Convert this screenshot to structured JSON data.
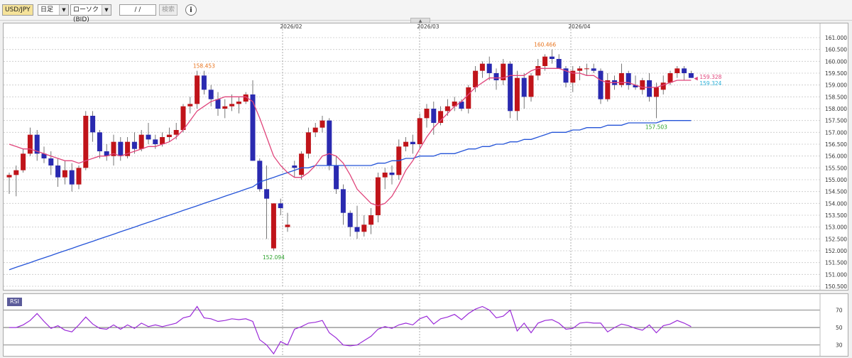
{
  "toolbar": {
    "symbol": "USD/JPY",
    "timeframe": "日足",
    "chart_type": "ローソク(BID)",
    "date_input": "/ /",
    "search_label": "検索",
    "info_icon": "info-icon"
  },
  "chart_data": [
    {
      "type": "candlestick",
      "title": "",
      "x_tick_labels": [
        "2026/02",
        "2026/03",
        "2026/04"
      ],
      "ylim": [
        150.5,
        161.0
      ],
      "y_ticks": [
        "161.000",
        "160.500",
        "160.000",
        "159.500",
        "159.000",
        "158.500",
        "158.000",
        "157.500",
        "157.000",
        "156.500",
        "156.000",
        "155.500",
        "155.000",
        "154.500",
        "154.000",
        "153.500",
        "153.000",
        "152.500",
        "152.000",
        "151.500",
        "151.000",
        "150.500"
      ],
      "grid": true,
      "candles": [
        [
          155.1,
          155.3,
          154.4,
          155.2
        ],
        [
          155.2,
          155.6,
          154.3,
          155.4
        ],
        [
          155.4,
          156.3,
          155.3,
          156.1
        ],
        [
          156.1,
          157.2,
          156.0,
          156.9
        ],
        [
          156.9,
          157.1,
          155.8,
          156.1
        ],
        [
          156.1,
          156.4,
          155.7,
          155.9
        ],
        [
          155.9,
          156.2,
          155.2,
          155.6
        ],
        [
          155.6,
          155.9,
          154.7,
          155.1
        ],
        [
          155.1,
          155.8,
          154.8,
          155.4
        ],
        [
          155.4,
          155.7,
          154.5,
          154.8
        ],
        [
          154.8,
          155.6,
          154.6,
          155.5
        ],
        [
          155.5,
          157.9,
          155.4,
          157.7
        ],
        [
          157.7,
          157.9,
          156.6,
          157.0
        ],
        [
          157.0,
          157.1,
          155.9,
          156.2
        ],
        [
          156.2,
          156.5,
          155.8,
          156.0
        ],
        [
          156.0,
          156.9,
          155.6,
          156.6
        ],
        [
          156.6,
          156.8,
          155.8,
          156.0
        ],
        [
          156.0,
          156.8,
          155.9,
          156.6
        ],
        [
          156.6,
          157.0,
          156.1,
          156.3
        ],
        [
          156.3,
          157.1,
          156.2,
          156.9
        ],
        [
          156.9,
          157.4,
          156.5,
          156.7
        ],
        [
          156.7,
          156.9,
          156.3,
          156.5
        ],
        [
          156.5,
          157.0,
          156.4,
          156.8
        ],
        [
          156.8,
          157.2,
          156.6,
          156.9
        ],
        [
          156.9,
          157.4,
          156.7,
          157.1
        ],
        [
          157.1,
          158.2,
          157.0,
          158.1
        ],
        [
          158.1,
          158.5,
          157.8,
          158.2
        ],
        [
          158.2,
          159.6,
          158.0,
          159.4
        ],
        [
          159.4,
          159.6,
          158.6,
          158.8
        ],
        [
          158.8,
          159.0,
          158.1,
          158.4
        ],
        [
          158.4,
          158.7,
          157.7,
          158.0
        ],
        [
          158.0,
          158.4,
          157.6,
          158.1
        ],
        [
          158.1,
          158.6,
          157.9,
          158.2
        ],
        [
          158.2,
          158.5,
          157.8,
          158.3
        ],
        [
          158.3,
          158.7,
          158.2,
          158.6
        ],
        [
          158.6,
          159.2,
          155.8,
          155.8
        ],
        [
          155.8,
          155.9,
          154.5,
          154.6
        ],
        [
          154.6,
          155.6,
          152.5,
          154.2
        ],
        [
          152.1,
          154.0,
          152.0,
          154.0
        ],
        [
          154.0,
          154.2,
          153.5,
          153.8
        ],
        [
          153.0,
          153.6,
          152.8,
          153.1
        ],
        [
          155.6,
          155.8,
          155.1,
          155.5
        ],
        [
          155.2,
          156.2,
          155.0,
          156.1
        ],
        [
          156.1,
          157.2,
          155.9,
          157.0
        ],
        [
          157.0,
          157.4,
          156.8,
          157.2
        ],
        [
          157.2,
          157.7,
          157.0,
          157.5
        ],
        [
          157.5,
          157.6,
          155.4,
          155.6
        ],
        [
          155.6,
          156.0,
          154.4,
          154.6
        ],
        [
          154.6,
          154.8,
          153.1,
          153.6
        ],
        [
          153.6,
          153.7,
          152.6,
          153.0
        ],
        [
          153.0,
          153.9,
          152.5,
          152.8
        ],
        [
          152.8,
          153.5,
          152.6,
          153.1
        ],
        [
          153.1,
          153.8,
          152.7,
          153.5
        ],
        [
          153.5,
          155.3,
          153.2,
          155.1
        ],
        [
          155.1,
          155.5,
          154.6,
          155.3
        ],
        [
          155.3,
          155.6,
          154.8,
          155.2
        ],
        [
          155.2,
          156.7,
          155.0,
          156.4
        ],
        [
          156.4,
          156.8,
          156.2,
          156.6
        ],
        [
          156.6,
          156.9,
          156.1,
          156.5
        ],
        [
          156.5,
          157.8,
          156.3,
          157.6
        ],
        [
          157.6,
          158.2,
          157.2,
          158.0
        ],
        [
          158.0,
          158.3,
          156.9,
          157.4
        ],
        [
          157.4,
          158.1,
          157.3,
          157.9
        ],
        [
          157.9,
          158.4,
          157.7,
          158.1
        ],
        [
          158.1,
          158.5,
          157.9,
          158.3
        ],
        [
          158.3,
          158.4,
          157.9,
          158.0
        ],
        [
          158.0,
          159.0,
          157.8,
          158.9
        ],
        [
          158.9,
          159.8,
          158.7,
          159.6
        ],
        [
          159.6,
          160.0,
          159.3,
          159.9
        ],
        [
          159.9,
          160.2,
          159.2,
          159.5
        ],
        [
          159.5,
          159.7,
          158.8,
          159.2
        ],
        [
          159.2,
          160.1,
          159.0,
          159.9
        ],
        [
          159.9,
          160.0,
          157.6,
          157.9
        ],
        [
          157.9,
          159.6,
          157.5,
          159.3
        ],
        [
          159.3,
          159.5,
          158.0,
          158.5
        ],
        [
          158.5,
          159.5,
          158.3,
          159.4
        ],
        [
          159.4,
          160.1,
          159.2,
          159.8
        ],
        [
          159.8,
          160.3,
          159.6,
          160.2
        ],
        [
          160.2,
          160.5,
          159.9,
          160.1
        ],
        [
          160.1,
          160.3,
          159.7,
          159.7
        ],
        [
          159.7,
          159.8,
          158.9,
          159.1
        ],
        [
          159.1,
          159.8,
          158.7,
          159.6
        ],
        [
          159.6,
          159.8,
          159.2,
          159.7
        ],
        [
          159.7,
          159.9,
          159.4,
          159.7
        ],
        [
          159.7,
          159.9,
          159.5,
          159.6
        ],
        [
          159.6,
          159.7,
          158.2,
          158.4
        ],
        [
          158.4,
          159.5,
          158.3,
          159.2
        ],
        [
          159.2,
          159.4,
          158.8,
          159.0
        ],
        [
          159.0,
          159.9,
          158.9,
          159.5
        ],
        [
          159.5,
          159.6,
          158.8,
          159.0
        ],
        [
          159.0,
          159.4,
          158.8,
          158.9
        ],
        [
          158.8,
          159.3,
          158.6,
          159.2
        ],
        [
          159.2,
          159.5,
          158.3,
          158.5
        ],
        [
          158.5,
          159.1,
          157.6,
          158.9
        ],
        [
          158.8,
          159.4,
          158.6,
          159.1
        ],
        [
          159.1,
          159.6,
          159.0,
          159.5
        ],
        [
          159.5,
          159.8,
          159.3,
          159.7
        ],
        [
          159.7,
          159.8,
          159.2,
          159.5
        ],
        [
          159.5,
          159.6,
          159.3,
          159.3
        ]
      ],
      "ma_short": [
        156.5,
        156.4,
        156.3,
        156.3,
        156.2,
        156.1,
        156.0,
        155.9,
        155.8,
        155.8,
        155.7,
        155.8,
        155.9,
        156.0,
        156.0,
        156.1,
        156.0,
        156.1,
        156.2,
        156.3,
        156.4,
        156.4,
        156.5,
        156.6,
        156.8,
        157.1,
        157.5,
        157.9,
        158.1,
        158.3,
        158.4,
        158.5,
        158.5,
        158.5,
        158.5,
        158.3,
        157.6,
        156.8,
        156.0,
        155.6,
        155.3,
        155.1,
        155.1,
        155.3,
        155.6,
        156.0,
        156.1,
        156.0,
        155.7,
        155.2,
        154.6,
        154.3,
        154.0,
        153.9,
        154.0,
        154.3,
        154.8,
        155.4,
        155.8,
        156.3,
        156.8,
        157.2,
        157.5,
        157.8,
        158.1,
        158.3,
        158.6,
        158.9,
        159.1,
        159.3,
        159.3,
        159.3,
        159.4,
        159.4,
        159.4,
        159.6,
        159.7,
        159.7,
        159.7,
        159.7,
        159.6,
        159.5,
        159.5,
        159.4,
        159.4,
        159.2,
        159.1,
        159.1,
        159.1,
        159.1,
        159.0,
        158.9,
        158.9,
        158.9,
        159.0,
        159.1,
        159.2,
        159.2,
        159.2
      ],
      "ma_long": [
        151.2,
        151.3,
        151.4,
        151.5,
        151.6,
        151.7,
        151.8,
        151.9,
        152.0,
        152.1,
        152.2,
        152.3,
        152.4,
        152.5,
        152.6,
        152.7,
        152.8,
        152.9,
        153.0,
        153.1,
        153.2,
        153.3,
        153.4,
        153.5,
        153.6,
        153.7,
        153.8,
        153.9,
        154.0,
        154.1,
        154.2,
        154.3,
        154.4,
        154.5,
        154.6,
        154.7,
        154.9,
        155.0,
        155.1,
        155.2,
        155.3,
        155.4,
        155.5,
        155.5,
        155.6,
        155.6,
        155.6,
        155.6,
        155.6,
        155.6,
        155.6,
        155.6,
        155.6,
        155.7,
        155.7,
        155.8,
        155.8,
        155.9,
        155.9,
        156.0,
        156.0,
        156.0,
        156.1,
        156.1,
        156.1,
        156.2,
        156.3,
        156.3,
        156.4,
        156.4,
        156.5,
        156.5,
        156.6,
        156.6,
        156.7,
        156.7,
        156.8,
        156.9,
        157.0,
        157.0,
        157.0,
        157.1,
        157.1,
        157.2,
        157.2,
        157.2,
        157.3,
        157.3,
        157.3,
        157.4,
        157.4,
        157.4,
        157.4,
        157.4,
        157.5,
        157.5,
        157.5,
        157.5,
        157.5
      ],
      "annotations": [
        {
          "text": "158.453",
          "price": 159.6,
          "candle": 28,
          "color": "#e8741e"
        },
        {
          "text": "152.094",
          "price": 152.0,
          "candle": 38,
          "color": "#2aa12a"
        },
        {
          "text": "160.466",
          "price": 160.5,
          "candle": 77,
          "color": "#e8741e"
        },
        {
          "text": "157.503",
          "price": 157.5,
          "candle": 93,
          "color": "#2aa12a"
        }
      ],
      "price_labels": [
        {
          "text": "159.328",
          "price": 159.35,
          "color": "#e0457b"
        },
        {
          "text": "159.324",
          "price": 159.2,
          "color": "#2ab0d8"
        }
      ],
      "colors": {
        "up": "#c0141a",
        "down": "#2a2ab0",
        "ma_short": "#e0457b",
        "ma_long": "#2554d8"
      }
    },
    {
      "type": "line",
      "title": "RSI",
      "ylim": [
        20,
        85
      ],
      "y_ticks": [
        "70",
        "50",
        "30"
      ],
      "values": [
        50,
        50,
        53,
        58,
        66,
        57,
        49,
        52,
        47,
        45,
        53,
        62,
        54,
        49,
        48,
        53,
        48,
        53,
        49,
        55,
        51,
        53,
        51,
        53,
        55,
        61,
        63,
        74,
        61,
        60,
        57,
        58,
        60,
        59,
        60,
        57,
        36,
        30,
        20,
        34,
        30,
        48,
        51,
        55,
        56,
        58,
        44,
        38,
        30,
        29,
        30,
        35,
        40,
        48,
        51,
        49,
        53,
        55,
        53,
        60,
        63,
        54,
        60,
        62,
        65,
        59,
        66,
        71,
        74,
        70,
        61,
        63,
        70,
        46,
        55,
        44,
        55,
        58,
        59,
        55,
        48,
        49,
        55,
        56,
        55,
        55,
        45,
        50,
        54,
        52,
        49,
        47,
        53,
        44,
        52,
        54,
        58,
        55,
        51
      ],
      "color": "#9a2ad8"
    }
  ]
}
